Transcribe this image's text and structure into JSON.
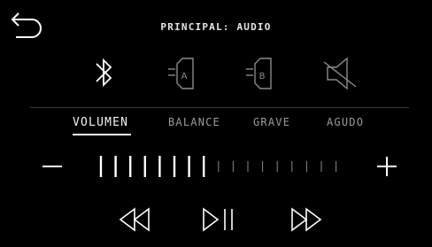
{
  "header": {
    "title": "PRINCIPAL: AUDIO",
    "back_icon": "back-arrow-icon"
  },
  "sources": [
    {
      "name": "bluetooth",
      "icon": "bluetooth-icon",
      "active": true
    },
    {
      "name": "speaker-a",
      "icon": "speaker-icon",
      "letter": "A",
      "active": false
    },
    {
      "name": "speaker-b",
      "icon": "speaker-icon",
      "letter": "B",
      "active": false
    },
    {
      "name": "mute",
      "icon": "speaker-mute-icon",
      "active": false
    }
  ],
  "tabs": [
    {
      "label": "VOLUMEN",
      "active": true
    },
    {
      "label": "BALANCE",
      "active": false
    },
    {
      "label": "GRAVE",
      "active": false
    },
    {
      "label": "AGUDO",
      "active": false
    }
  ],
  "volume": {
    "level": 8,
    "max": 17,
    "minus_icon": "minus-icon",
    "plus_icon": "plus-icon"
  },
  "transport": [
    {
      "name": "previous",
      "icon": "rewind-icon"
    },
    {
      "name": "play-pause",
      "icon": "play-pause-icon"
    },
    {
      "name": "next",
      "icon": "fast-forward-icon"
    }
  ],
  "colors": {
    "background": "#000000",
    "active": "#ffffff",
    "inactive": "#8a8a8a",
    "divider": "#3a3a3a"
  }
}
